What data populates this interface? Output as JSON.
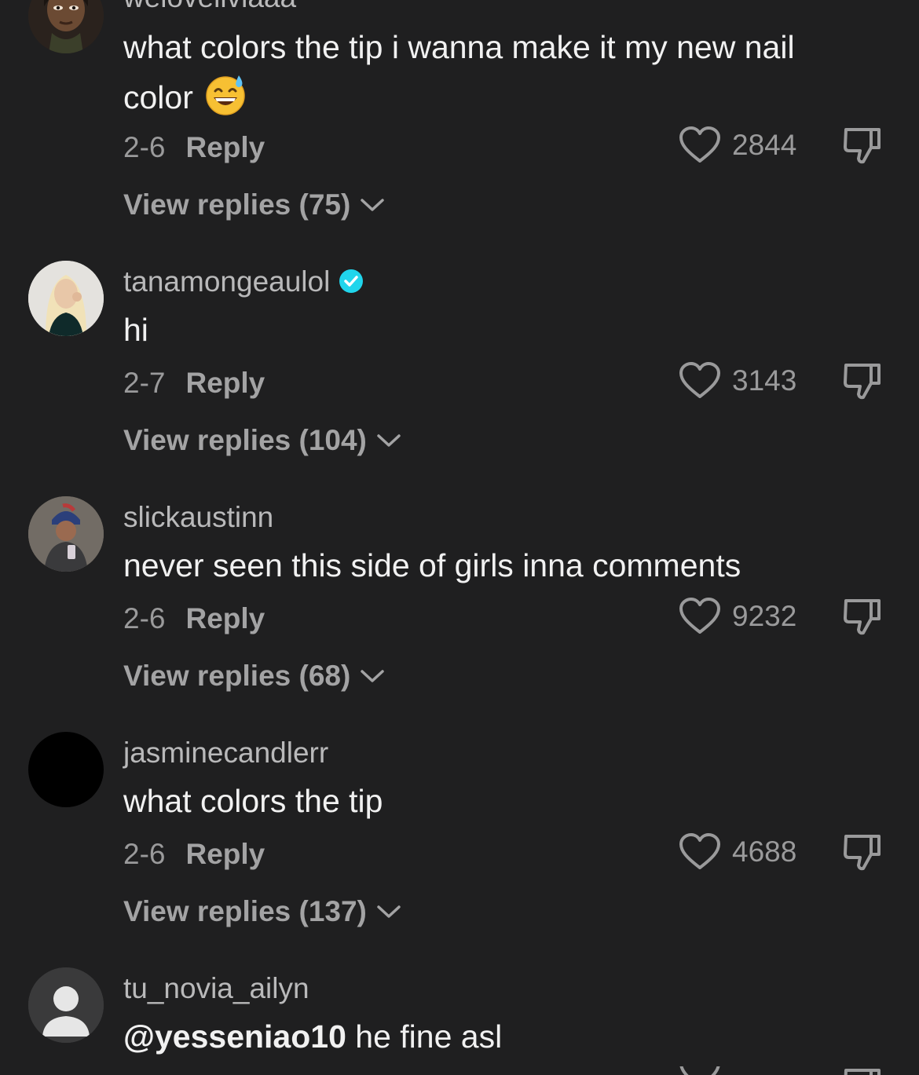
{
  "comments": [
    {
      "username": "weloveilviaaa",
      "text": "what colors the tip i wanna make it my new nail color",
      "emoji": "grinning-sweat-emoji",
      "date": "2-6",
      "reply_label": "Reply",
      "likes": "2844",
      "view_replies": "View replies (75)",
      "verified": false
    },
    {
      "username": "tanamongeaulol",
      "text": "hi",
      "date": "2-7",
      "reply_label": "Reply",
      "likes": "3143",
      "view_replies": "View replies (104)",
      "verified": true
    },
    {
      "username": "slickaustinn",
      "text": "never seen this side of girls inna comments",
      "date": "2-6",
      "reply_label": "Reply",
      "likes": "9232",
      "view_replies": "View replies (68)",
      "verified": false
    },
    {
      "username": "jasminecandlerr",
      "text": "what colors the tip",
      "date": "2-6",
      "reply_label": "Reply",
      "likes": "4688",
      "view_replies": "View replies (137)",
      "verified": false
    },
    {
      "username": "tu_novia_ailyn",
      "mention": "@yesseniao10",
      "text": " he fine asl",
      "verified": false
    }
  ],
  "colors": {
    "background": "#1f1f20",
    "verified_badge": "#20d5ec"
  }
}
